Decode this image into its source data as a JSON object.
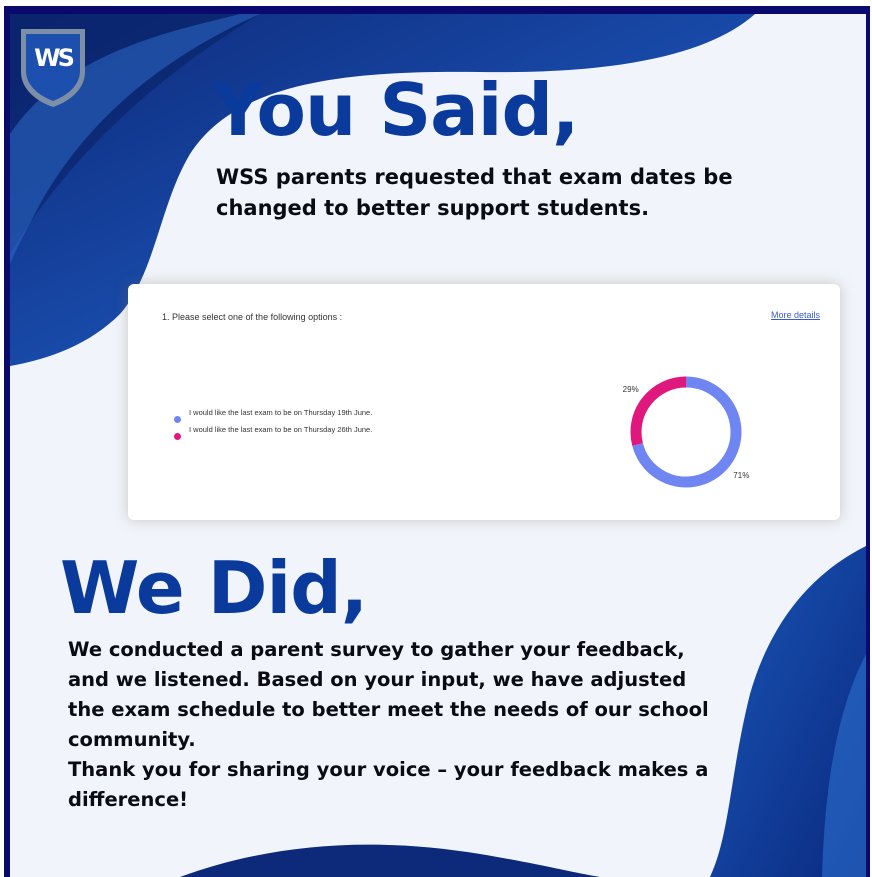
{
  "logo": {
    "text": "WS"
  },
  "you_said": {
    "heading": "You Said,",
    "text": "WSS parents requested that exam dates be changed to better support students."
  },
  "survey": {
    "question": "1. Please select one of the following options :",
    "more_details": "More details",
    "link_color": "#3a5bd0"
  },
  "chart_data": {
    "type": "pie",
    "style": "donut",
    "categories": [
      "I would like the last exam to be on Thursday 19th June.",
      "I would like the last exam to be on Thursday 26th June."
    ],
    "values": [
      71,
      29
    ],
    "value_labels": [
      "71%",
      "29%"
    ],
    "colors": [
      "#6f85f2",
      "#e0177c"
    ],
    "legend_position": "left"
  },
  "we_did": {
    "heading": "We Did,",
    "paragraph1": "We conducted a parent survey to gather your feedback, and we listened. Based on your input, we have adjusted the exam schedule to better meet the needs of our school community.",
    "paragraph2": "Thank you for sharing your voice – your feedback makes a difference!"
  },
  "colors": {
    "brand_dark": "#0a0a6e",
    "brand_blue": "#0a3a9c",
    "background": "#f1f5fb"
  }
}
